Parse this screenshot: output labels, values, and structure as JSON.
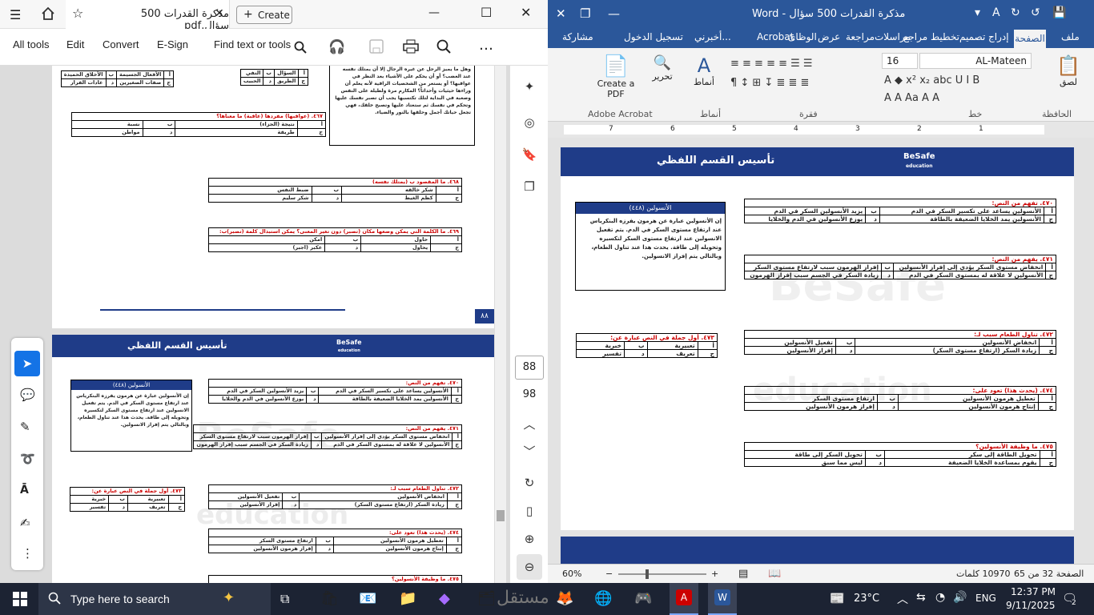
{
  "acrobat": {
    "tab_title": "مذكرة القدرات 500 سؤال.pdf",
    "new_tab": "Create",
    "toolbar": {
      "all_tools": "All tools",
      "edit": "Edit",
      "convert": "Convert",
      "esign": "E-Sign",
      "find": "Find text or tools"
    },
    "page_num": "88",
    "page_total": "98",
    "page_badge": "٨٨",
    "page1": {
      "table_tl": [
        [
          "أ",
          "الأفعال الجسيمة",
          "ب",
          "الأخلاق الحميدة"
        ],
        [
          "ج",
          "صفات الصغيرين",
          "د",
          "عادات الفرار"
        ]
      ],
      "table_tm": [
        [
          "أ",
          "السؤال",
          "ب",
          "النفي"
        ],
        [
          "ج",
          "الطريق",
          "د",
          "الحبيب"
        ]
      ],
      "paragraph": "وهل ما يميز الرجل عن غيره الرجال إلا أن يمتلك نفسه عند الغضب؟ أو أن يحكم على الأشياء بعد النظر في عواقبها؟ أو يستعر من الشخصيات الراقية لأنه يعلم أن وراءها حيثيات وأحداثاً؟ المكارم مرة ولطيلة على النفس وصعبة في البداية لتلك تكتسبها يجب أن تصبر نفسك عليها وتحكم في نفسك ثم ستعتاد عليها وتصبح خلقك، فهي تجعل حياتك أجمل وحلقها بالنور والضياء.",
      "q467": "٤٦٧. (عواقبها) مفردها (عاقبة) ما معناها؟",
      "q467_opts": [
        [
          "أ",
          "نتيجة (الجزاء)",
          "ب",
          "نسبة"
        ],
        [
          "ج",
          "طريقة",
          "د",
          "مواطن"
        ]
      ],
      "q468": "٤٦٨. ما المقصود ب (يمتلك نفسه)",
      "q468_opts": [
        [
          "أ",
          "شكر خالقه",
          "ب",
          "ضبط النفس"
        ],
        [
          "ج",
          "كظم الغيظ",
          "د",
          "شكر سليم"
        ]
      ],
      "q469": "٤٦٩. ما الكلمة التي يمكن وضعها مكان (تصبر) دون تغير المعنى؟ يمكن استبدال كلمة (تصبر)ب:",
      "q469_opts": [
        [
          "أ",
          "حاول",
          "ب",
          "امكن"
        ],
        [
          "ج",
          "يحاول",
          "د",
          "عكبر (اجبر)"
        ]
      ]
    },
    "page2": {
      "header": "تأسيس القسم اللفظي",
      "logo": "BeSafe",
      "logo_sub": "education",
      "watermark": "BeSafe",
      "watermark_sub": "education"
    }
  },
  "word": {
    "title": "مذكرة القدرات 500 سؤال - Word",
    "tabs": [
      "ملف",
      "الصفحة الرئيسية",
      "إدراج",
      "تصميم",
      "تخطيط",
      "مراجع",
      "مراسلات",
      "مراجعة",
      "عرض",
      "الوظائف",
      "Acrobat",
      "أخبرني...",
      "تسجيل الدخول",
      "مشاركة"
    ],
    "tabs_display": [
      "ملف",
      "الصفحة",
      "إدراج",
      "تصميم",
      "تخطيط",
      "مراجع",
      "مراسلات",
      "مراجعة",
      "عرض",
      "الوظائ",
      "Acrobat",
      "أخبرني...",
      "تسجيل الدخول",
      "مشاركة"
    ],
    "ribbon": {
      "clipboard": "الحافظة",
      "paste": "لصق",
      "font_group": "خط",
      "paragraph_group": "فقرة",
      "styles_group": "أنماط",
      "styles": "أنماط",
      "edit": "تحرير",
      "font_name": "AL-Mateen",
      "font_size": "16",
      "acrobat_group": "Adobe Acrobat",
      "create_pdf": "Create a PDF"
    },
    "ruler": [
      "1",
      "2",
      "3",
      "4",
      "5",
      "6",
      "7"
    ],
    "status": {
      "page": "الصفحة 32 من 65",
      "words": "10970 كلمات",
      "zoom": "60%"
    },
    "page": {
      "header": "تأسيس القسم اللفظي",
      "logo": "BeSafe",
      "logo_sub": "education",
      "watermark": "BeSafe",
      "watermark_sub": "education",
      "box_title": "(٤٤٨) الأنسولين",
      "box_text": "إن الأنسولين عبارة عن هرمون يفرزه البنكرياس عند ارتفاع مستوى السكر في الدم. يتم تفعيل الانسولين عند ارتفاع مستوى السكر لتكسيره وتحويله إلى طاقة. يحدث هذا عند تناول الطعام، وبالتالي يتم إفراز الانسولين.",
      "q470": "٤٧٠. تفهم من النص:",
      "q470_opts": [
        [
          "أ",
          "الأنسولين يساعد على تكسير السكر في الدم",
          "ب",
          "يزيد الأنسولين السكر في الدم"
        ],
        [
          "ج",
          "الأنسولين يمد الخلايا الضعيفة بالطاقة",
          "د",
          "يوزع الأنسولين في الدم والخلايا"
        ]
      ],
      "q471": "٤٧١. يفهم من النص:",
      "q471_opts": [
        [
          "أ",
          "انخفاض مستوى السكر يؤدي إلى إفراز الأنسولين",
          "ب",
          "إفراز الهرمون سبب لارتفاع مستوى السكر"
        ],
        [
          "ج",
          "الأنسولين لا علاقة له بمستوى السكر في الدم",
          "د",
          "زيادة السكر في الجسم سبب إفراز الهرمون"
        ]
      ],
      "q472": "٤٧٢. تناول الطعام سبب لـ:",
      "q472_opts": [
        [
          "أ",
          "انخفاض الأنسولين",
          "ب",
          "تفعيل الأنسولين"
        ],
        [
          "ج",
          "زيادة السكر (ارتفاع مستوى السكر)",
          "د",
          "إفراز الأنسولين"
        ]
      ],
      "q473": "٤٧٣. أول جملة في النص عبارة عن:",
      "q473_opts": [
        [
          "أ",
          "تعبيرية",
          "ب",
          "خبرية"
        ],
        [
          "ج",
          "تعريف",
          "د",
          "تفسير"
        ]
      ],
      "q474": "٤٧٤. (يحدث هذا) تعود على:",
      "q474_opts": [
        [
          "أ",
          "تعطيل هرمون الأنسولين",
          "ب",
          "ارتفاع مستوى السكر"
        ],
        [
          "ج",
          "إنتاج هرمون الأنسولين",
          "د",
          "إفراز هرمون الأنسولين"
        ]
      ],
      "q475": "٤٧٥. ما وظيفة الأنسولين؟",
      "q475_opts": [
        [
          "أ",
          "تحويل الطاقة إلى سكر",
          "ب",
          "تحويل السكر إلى طاقة"
        ],
        [
          "ج",
          "يقوم بمساعدة الخلايا الضعيفة",
          "د",
          "ليس مما سبق"
        ]
      ]
    }
  },
  "taskbar": {
    "search": "Type here to search",
    "temp": "23°C",
    "lang": "ENG",
    "time": "12:37 PM",
    "date": "9/11/2025",
    "notif": "2",
    "watermark": "مستقل"
  }
}
